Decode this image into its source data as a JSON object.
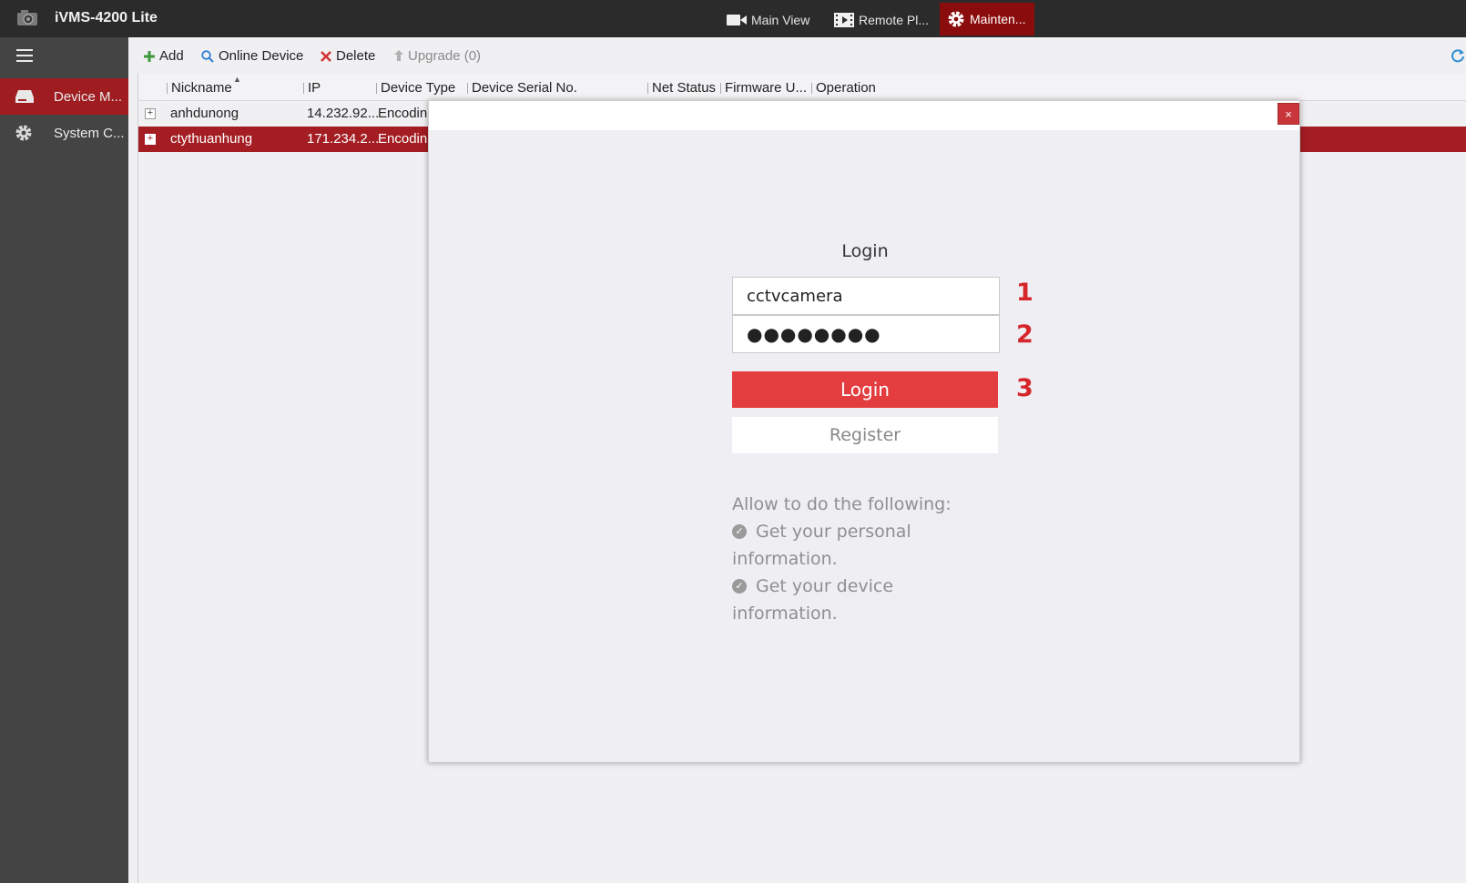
{
  "app": {
    "title": "iVMS-4200 Lite"
  },
  "top_tabs": [
    {
      "label": "Main View"
    },
    {
      "label": "Remote Pl..."
    },
    {
      "label": "Mainten..."
    }
  ],
  "sidebar": {
    "items": [
      {
        "label": "Device M...",
        "active": true
      },
      {
        "label": "System C..."
      }
    ]
  },
  "toolbar": {
    "add_label": "Add",
    "online_label": "Online Device",
    "delete_label": "Delete",
    "upgrade_label": "Upgrade (0)"
  },
  "table": {
    "columns": [
      "Nickname",
      "IP",
      "Device Type",
      "Device Serial No.",
      "Net Status",
      "Firmware U...",
      "Operation"
    ],
    "rows": [
      {
        "nickname": "anhdunong",
        "ip": "14.232.92...",
        "type": "Encodin"
      },
      {
        "nickname": "ctythuanhung",
        "ip": "171.234.2...",
        "type": "Encodin",
        "selected": true
      }
    ]
  },
  "modal": {
    "close_label": "×",
    "title": "Login",
    "username": "cctvcamera",
    "password": "●●●●●●●●",
    "login_label": "Login",
    "register_label": "Register",
    "steps": [
      "1",
      "2",
      "3"
    ],
    "allow_heading": "Allow to do the following:",
    "permissions": [
      "Get your personal information.",
      "Get your device information."
    ]
  },
  "colors": {
    "brand_red": "#a31d22",
    "button_red": "#e33d3f",
    "step_red": "#d5262c"
  }
}
